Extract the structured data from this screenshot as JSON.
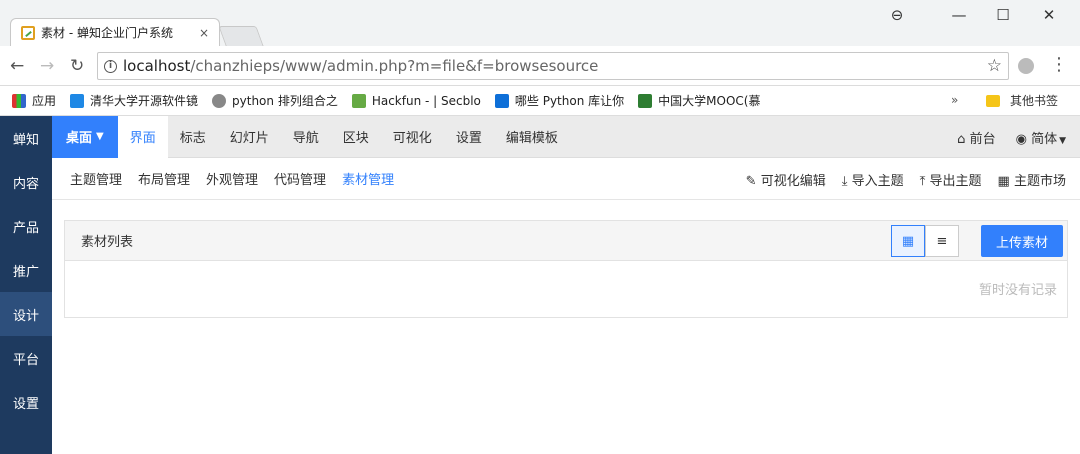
{
  "browser": {
    "tab_title": "素材 - 蝉知企业门户系统",
    "tab_close": "×",
    "url_host": "localhost",
    "url_path": "/chanzhieps/www/admin.php?m=file&f=browsesource",
    "win_controls": [
      "⊖",
      "—",
      "☐",
      "✕"
    ],
    "bookmarks": [
      "应用",
      "清华大学开源软件镜",
      "python 排列组合之",
      "Hackfun - | Secblo",
      "哪些 Python 库让你",
      "中国大学MOOC(慕"
    ],
    "bookmarks_more": "»",
    "bookmarks_other": "其他书签"
  },
  "sidebar": {
    "items": [
      "蝉知",
      "内容",
      "产品",
      "推广",
      "设计",
      "平台",
      "设置"
    ],
    "active_index": 4
  },
  "topnav": {
    "desktop": "桌面",
    "items": [
      "界面",
      "标志",
      "幻灯片",
      "导航",
      "区块",
      "可视化",
      "设置",
      "编辑模板"
    ],
    "active_index": 0,
    "frontend": "前台",
    "language": "简体"
  },
  "subnav": {
    "items": [
      "主题管理",
      "布局管理",
      "外观管理",
      "代码管理",
      "素材管理"
    ],
    "active_index": 4,
    "actions": [
      "可视化编辑",
      "导入主题",
      "导出主题",
      "主题市场"
    ]
  },
  "panel": {
    "title": "素材列表",
    "upload": "上传素材",
    "empty": "暂时没有记录"
  },
  "colors": {
    "accent": "#3280fc",
    "sidebar": "#1e3a5f"
  }
}
